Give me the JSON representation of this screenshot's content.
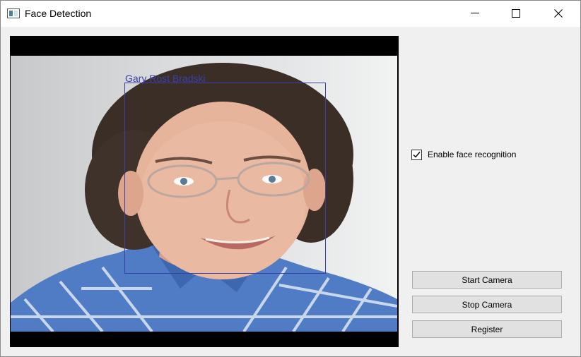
{
  "window": {
    "title": "Face Detection",
    "icons": [
      "app-icon",
      "minimize-icon",
      "maximize-icon",
      "close-icon"
    ]
  },
  "video": {
    "detected_name": "Gary Rost Bradski"
  },
  "controls": {
    "face_recognition_label": "Enable face recognition",
    "face_recognition_checked": true,
    "start_camera_label": "Start Camera",
    "stop_camera_label": "Stop Camera",
    "register_label": "Register"
  },
  "colors": {
    "face_box": "#3b3fa8",
    "window_bg": "#f0f0f0",
    "button_bg": "#e1e1e1"
  }
}
